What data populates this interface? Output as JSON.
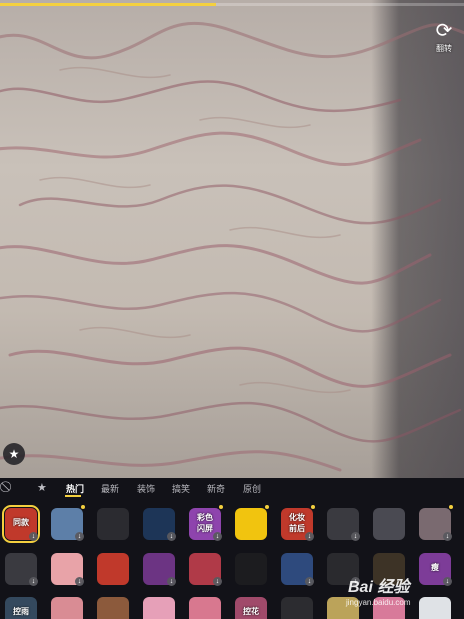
{
  "app": {
    "recording_progress": 0.465,
    "flip_label": "翻转",
    "accent_color": "#f4d03f"
  },
  "tabs": {
    "icons": [
      "no-effect-icon",
      "favorites-star-icon"
    ],
    "labels": [
      "热门",
      "最新",
      "装饰",
      "搞笑",
      "新奇",
      "原创"
    ],
    "active": "热门"
  },
  "effects": {
    "row1": [
      {
        "caption": "同款",
        "selected": true,
        "icon": "framed-text"
      },
      {
        "caption": "",
        "icon": "blue-glitch"
      },
      {
        "caption": "",
        "icon": "black-mask"
      },
      {
        "caption": "",
        "icon": "intel-chip"
      },
      {
        "caption": "彩色\n闪屏",
        "icon": "color-flash"
      },
      {
        "caption": "",
        "icon": "yellow-duck"
      },
      {
        "caption": "化妆\n前后",
        "icon": "before-after"
      },
      {
        "caption": "",
        "icon": "cat-ears-lines"
      },
      {
        "caption": "",
        "icon": "dark-portrait"
      },
      {
        "caption": "",
        "icon": "face-pair"
      }
    ],
    "row2": [
      {
        "caption": "",
        "icon": "bunny"
      },
      {
        "caption": "",
        "icon": "pink-face"
      },
      {
        "caption": "",
        "icon": "red-gift"
      },
      {
        "caption": "",
        "icon": "purple-sparkle"
      },
      {
        "caption": "",
        "icon": "lips"
      },
      {
        "caption": "",
        "icon": "black-text"
      },
      {
        "caption": "",
        "icon": "blue-character"
      },
      {
        "caption": "",
        "icon": "dark-dots"
      },
      {
        "caption": "",
        "icon": "fox-face"
      },
      {
        "caption": "瘦",
        "icon": "slim-purple"
      }
    ],
    "row3": [
      {
        "caption": "控雨",
        "icon": "rain-control"
      },
      {
        "caption": "",
        "icon": "pink-face-2"
      },
      {
        "caption": "",
        "icon": "portrait-frame"
      },
      {
        "caption": "",
        "icon": "pink-flowers"
      },
      {
        "caption": "",
        "icon": "pink-heart"
      },
      {
        "caption": "控花",
        "icon": "flower-control"
      },
      {
        "caption": "",
        "icon": "dark-blank"
      },
      {
        "caption": "",
        "icon": "butterfly"
      },
      {
        "caption": "",
        "icon": "pink-save"
      },
      {
        "caption": "",
        "icon": "white-face"
      }
    ]
  },
  "watermark": {
    "brand": "Bai 经验",
    "url": "jingyan.baidu.com"
  }
}
